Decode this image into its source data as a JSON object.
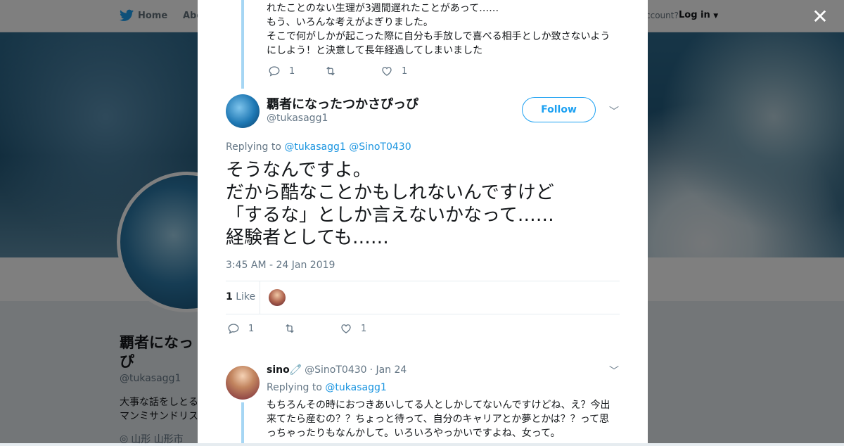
{
  "topbar": {
    "home_label": "Home",
    "about_label": "Abo",
    "account_prompt": "ccount?",
    "login_label": "Log in"
  },
  "profile": {
    "name": "覇者になっ\nぴ",
    "handle": "@tukasagg1",
    "bio": "大事な話をしとる\nマンミサンドリス",
    "location": "山形 山形市"
  },
  "previous_tweet": {
    "text": "れたことのない生理が3週間遅れたことがあって……\nもう、いろんな考えがよぎりました。\nそこで何がしかが起こった際に自分も手放しで喜べる相手としか致さないよう\nにしよう！と決意して長年経過してしまいました",
    "reply_count": "1",
    "retweet_count": "",
    "like_count": "1"
  },
  "main_tweet": {
    "name": "覇者になったつかさぴっぴ",
    "handle": "@tukasagg1",
    "follow_label": "Follow",
    "replying_to_label": "Replying to",
    "replying_to": [
      "@tukasagg1",
      "@SinoT0430"
    ],
    "text": "そうなんですよ。\nだから酷なことかもしれないんですけど\n「するな」としか言えないかなって……\n経験者としても……",
    "timestamp": "3:45 AM - 24 Jan 2019",
    "likes_count": "1",
    "likes_label": "Like",
    "reply_count": "1",
    "retweet_count": "",
    "like_count": "1"
  },
  "reply_tweet": {
    "name": "sino",
    "name_emoji": "🧷",
    "handle": "@SinoT0430",
    "date": "· Jan 24",
    "replying_to_label": "Replying to",
    "replying_to": "@tukasagg1",
    "text": "もちろんその時におつきあいしてる人としかしてないんですけどね、え？今出来てたら産むの？？ちょっと待って、自分のキャリアとか夢とかは？？って思っちゃったりもなんかして。いろいろやっかいですよね、女って。"
  },
  "colors": {
    "twitter_blue": "#1da1f2",
    "link": "#1b95e0",
    "thread_line": "#a6d6f4",
    "text": "#14171a",
    "muted": "#657786"
  }
}
